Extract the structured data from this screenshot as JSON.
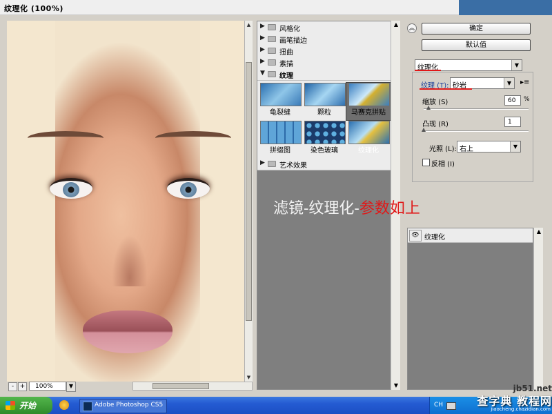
{
  "window": {
    "title": "纹理化 (100%)"
  },
  "preview": {
    "zoom": "100%",
    "zoom_out_label": "-",
    "zoom_in_label": "+"
  },
  "gallery": {
    "categories": [
      "风格化",
      "画笔描边",
      "扭曲",
      "素描",
      "纹理",
      "艺术效果"
    ],
    "open_category": "纹理",
    "texture_filters": [
      "龟裂缝",
      "颗粒",
      "马赛克拼贴",
      "拼缀图",
      "染色玻璃",
      "纹理化"
    ],
    "selected_filter": "纹理化"
  },
  "overlay": {
    "prefix": "滤镜-纹理化-",
    "suffix": "参数如上"
  },
  "buttons": {
    "ok": "确定",
    "default": "默认值"
  },
  "settings": {
    "filter_name": "纹理化",
    "texture_label": "纹理 (T):",
    "texture_value": "砂岩",
    "scaling_label": "缩放 (S)",
    "scaling_value": "60",
    "scaling_unit": "%",
    "relief_label": "凸现 (R)",
    "relief_value": "1",
    "light_label": "光照 (L):",
    "light_value": "右上",
    "invert_label": "反相 (I)",
    "invert_checked": false
  },
  "layers": {
    "effect_name": "纹理化"
  },
  "taskbar": {
    "start_label": "开始",
    "task_label": "Adobe Photoshop CS5",
    "lang": "CH"
  },
  "watermark": {
    "site": "jb51.net",
    "cn": "查字典 教程网",
    "url": "jiaocheng.chazidian.com"
  },
  "colors": {
    "accent_red": "#e01818",
    "taskbar_blue": "#245bd2",
    "panel_gray": "#7f7f7f"
  }
}
